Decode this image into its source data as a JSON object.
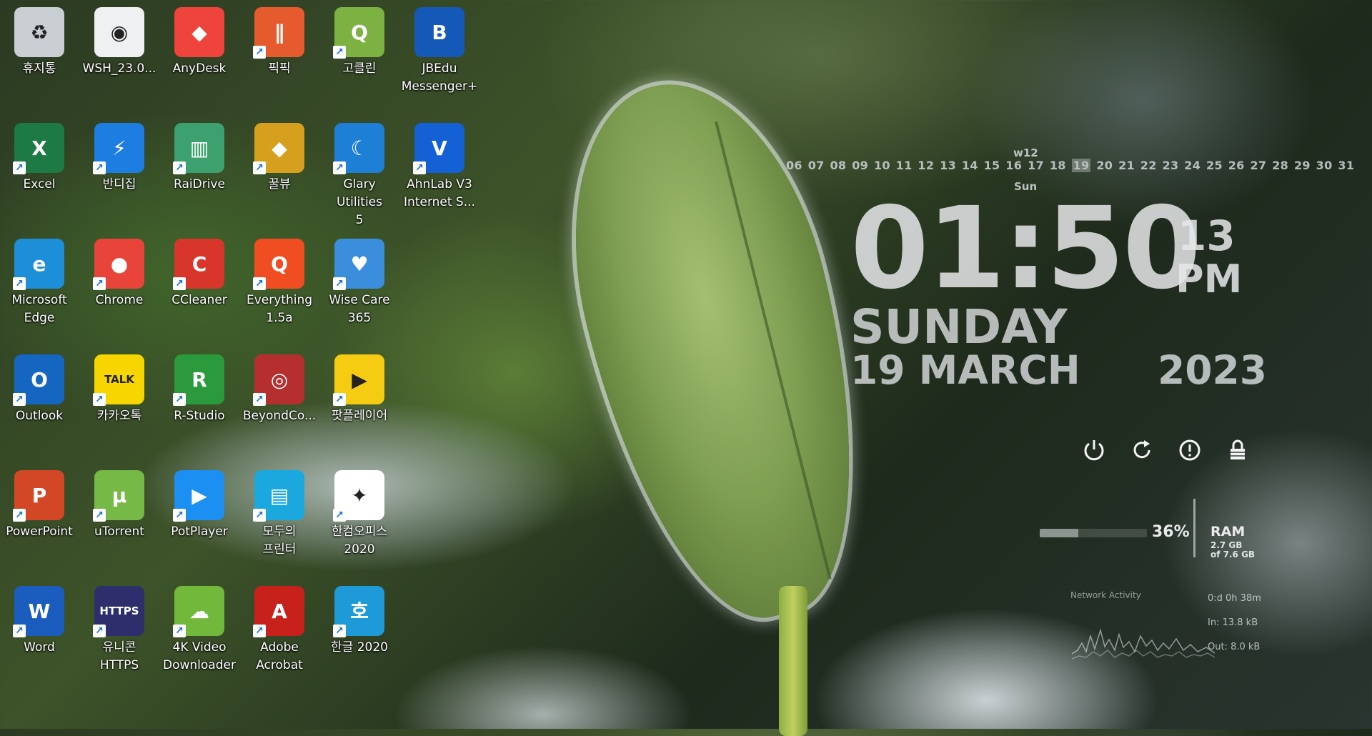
{
  "desktop": {
    "columns": [
      [
        {
          "label": "휴지통",
          "icon": "recycle-bin-icon",
          "glyph": "♻",
          "color": "#c9ced3",
          "shortcut": false
        },
        {
          "label": "Excel",
          "icon": "excel-icon",
          "glyph": "X",
          "color": "#1d7a44",
          "shortcut": true
        },
        {
          "label": "Microsoft\nEdge",
          "icon": "edge-icon",
          "glyph": "e",
          "color": "#1c8fd8",
          "shortcut": true
        },
        {
          "label": "Outlook",
          "icon": "outlook-icon",
          "glyph": "O",
          "color": "#1466c0",
          "shortcut": true
        },
        {
          "label": "PowerPoint",
          "icon": "powerpoint-icon",
          "glyph": "P",
          "color": "#d24726",
          "shortcut": true
        },
        {
          "label": "Word",
          "icon": "word-icon",
          "glyph": "W",
          "color": "#1a5dbf",
          "shortcut": true
        }
      ],
      [
        {
          "label": "WSH_23.0...",
          "icon": "file-icon",
          "glyph": "◉",
          "color": "#eef0f2",
          "shortcut": false
        },
        {
          "label": "반디집",
          "icon": "bandizip-icon",
          "glyph": "⚡",
          "color": "#1d7de0",
          "shortcut": true
        },
        {
          "label": "Chrome",
          "icon": "chrome-icon",
          "glyph": "●",
          "color": "#e9443a",
          "shortcut": true
        },
        {
          "label": "카카오톡",
          "icon": "kakaotalk-icon",
          "glyph": "TALK",
          "color": "#f7d600",
          "shortcut": true
        },
        {
          "label": "uTorrent",
          "icon": "utorrent-icon",
          "glyph": "µ",
          "color": "#76b947",
          "shortcut": true
        },
        {
          "label": "유니콘\nHTTPS",
          "icon": "unicorn-icon",
          "glyph": "HTTPS",
          "color": "#2d2e6b",
          "shortcut": true
        }
      ],
      [
        {
          "label": "AnyDesk",
          "icon": "anydesk-icon",
          "glyph": "◆",
          "color": "#ef443b",
          "shortcut": false
        },
        {
          "label": "RaiDrive",
          "icon": "raidrive-icon",
          "glyph": "▥",
          "color": "#3ca06f",
          "shortcut": true
        },
        {
          "label": "CCleaner",
          "icon": "ccleaner-icon",
          "glyph": "C",
          "color": "#d8362a",
          "shortcut": true
        },
        {
          "label": "R-Studio",
          "icon": "r-studio-icon",
          "glyph": "R",
          "color": "#2b9a3c",
          "shortcut": true
        },
        {
          "label": "PotPlayer",
          "icon": "potplayer-icon",
          "glyph": "▶",
          "color": "#1c8ff2",
          "shortcut": true
        },
        {
          "label": "4K Video\nDownloader",
          "icon": "4k-video-downloader-icon",
          "glyph": "☁",
          "color": "#72b83a",
          "shortcut": true
        }
      ],
      [
        {
          "label": "픽픽",
          "icon": "picpick-icon",
          "glyph": "∥",
          "color": "#e65b2e",
          "shortcut": true
        },
        {
          "label": "꿀뷰",
          "icon": "honeyview-icon",
          "glyph": "◆",
          "color": "#d6a01e",
          "shortcut": true
        },
        {
          "label": "Everything\n1.5a",
          "icon": "everything-icon",
          "glyph": "Q",
          "color": "#f04d23",
          "shortcut": true
        },
        {
          "label": "BeyondCo...",
          "icon": "beyond-compare-icon",
          "glyph": "◎",
          "color": "#b52f2f",
          "shortcut": true
        },
        {
          "label": "모두의\n프린터",
          "icon": "printer-icon",
          "glyph": "▤",
          "color": "#1aa8de",
          "shortcut": true
        },
        {
          "label": "Adobe\nAcrobat",
          "icon": "acrobat-icon",
          "glyph": "A",
          "color": "#c8211c",
          "shortcut": true
        }
      ],
      [
        {
          "label": "고클린",
          "icon": "goclean-icon",
          "glyph": "Q",
          "color": "#7cb242",
          "shortcut": true
        },
        {
          "label": "Glary Utilities\n5",
          "icon": "glary-icon",
          "glyph": "☾",
          "color": "#1e7fd6",
          "shortcut": true
        },
        {
          "label": "Wise Care\n365",
          "icon": "wise-care-icon",
          "glyph": "♥",
          "color": "#3a8edc",
          "shortcut": true
        },
        {
          "label": "팟플레이어",
          "icon": "potplayer-yellow-icon",
          "glyph": "▶",
          "color": "#f5cc11",
          "shortcut": true
        },
        {
          "label": "한컴오피스\n2020",
          "icon": "hancom-office-icon",
          "glyph": "✦",
          "color": "#ffffff",
          "shortcut": true
        },
        {
          "label": "한글 2020",
          "icon": "hangul-icon",
          "glyph": "호",
          "color": "#1f9ad8",
          "shortcut": true
        }
      ],
      [
        {
          "label": "JBEdu\nMessenger+",
          "icon": "jbedu-messenger-icon",
          "glyph": "B",
          "color": "#1559b8",
          "shortcut": false
        },
        {
          "label": "AhnLab V3\nInternet S...",
          "icon": "ahnlab-icon",
          "glyph": "V",
          "color": "#1461d6",
          "shortcut": true
        }
      ]
    ]
  },
  "clock": {
    "week": "w12",
    "days_before": "06 07 08 09 10 11 12 13 14 15 16 17 18",
    "today": "19",
    "days_after": "20 21 22 23 24 25 26 27 28 29 30 31",
    "weekday_short": "Sun",
    "time": "01:50",
    "seconds": "13",
    "ampm": "PM",
    "weekday": "SUNDAY",
    "date": "19 MARCH",
    "year": "2023"
  },
  "power_buttons": [
    "power-icon",
    "restart-icon",
    "sleep-icon",
    "lock-icon"
  ],
  "ram": {
    "label": "RAM",
    "percent": "36%",
    "percent_value": 0.36,
    "used": "2.7 GB",
    "total": "of 7.6 GB"
  },
  "network": {
    "title": "Network Activity",
    "uptime": "0:d 0h 38m",
    "in": "In: 13.8 kB",
    "out": "Out: 8.0 kB"
  }
}
